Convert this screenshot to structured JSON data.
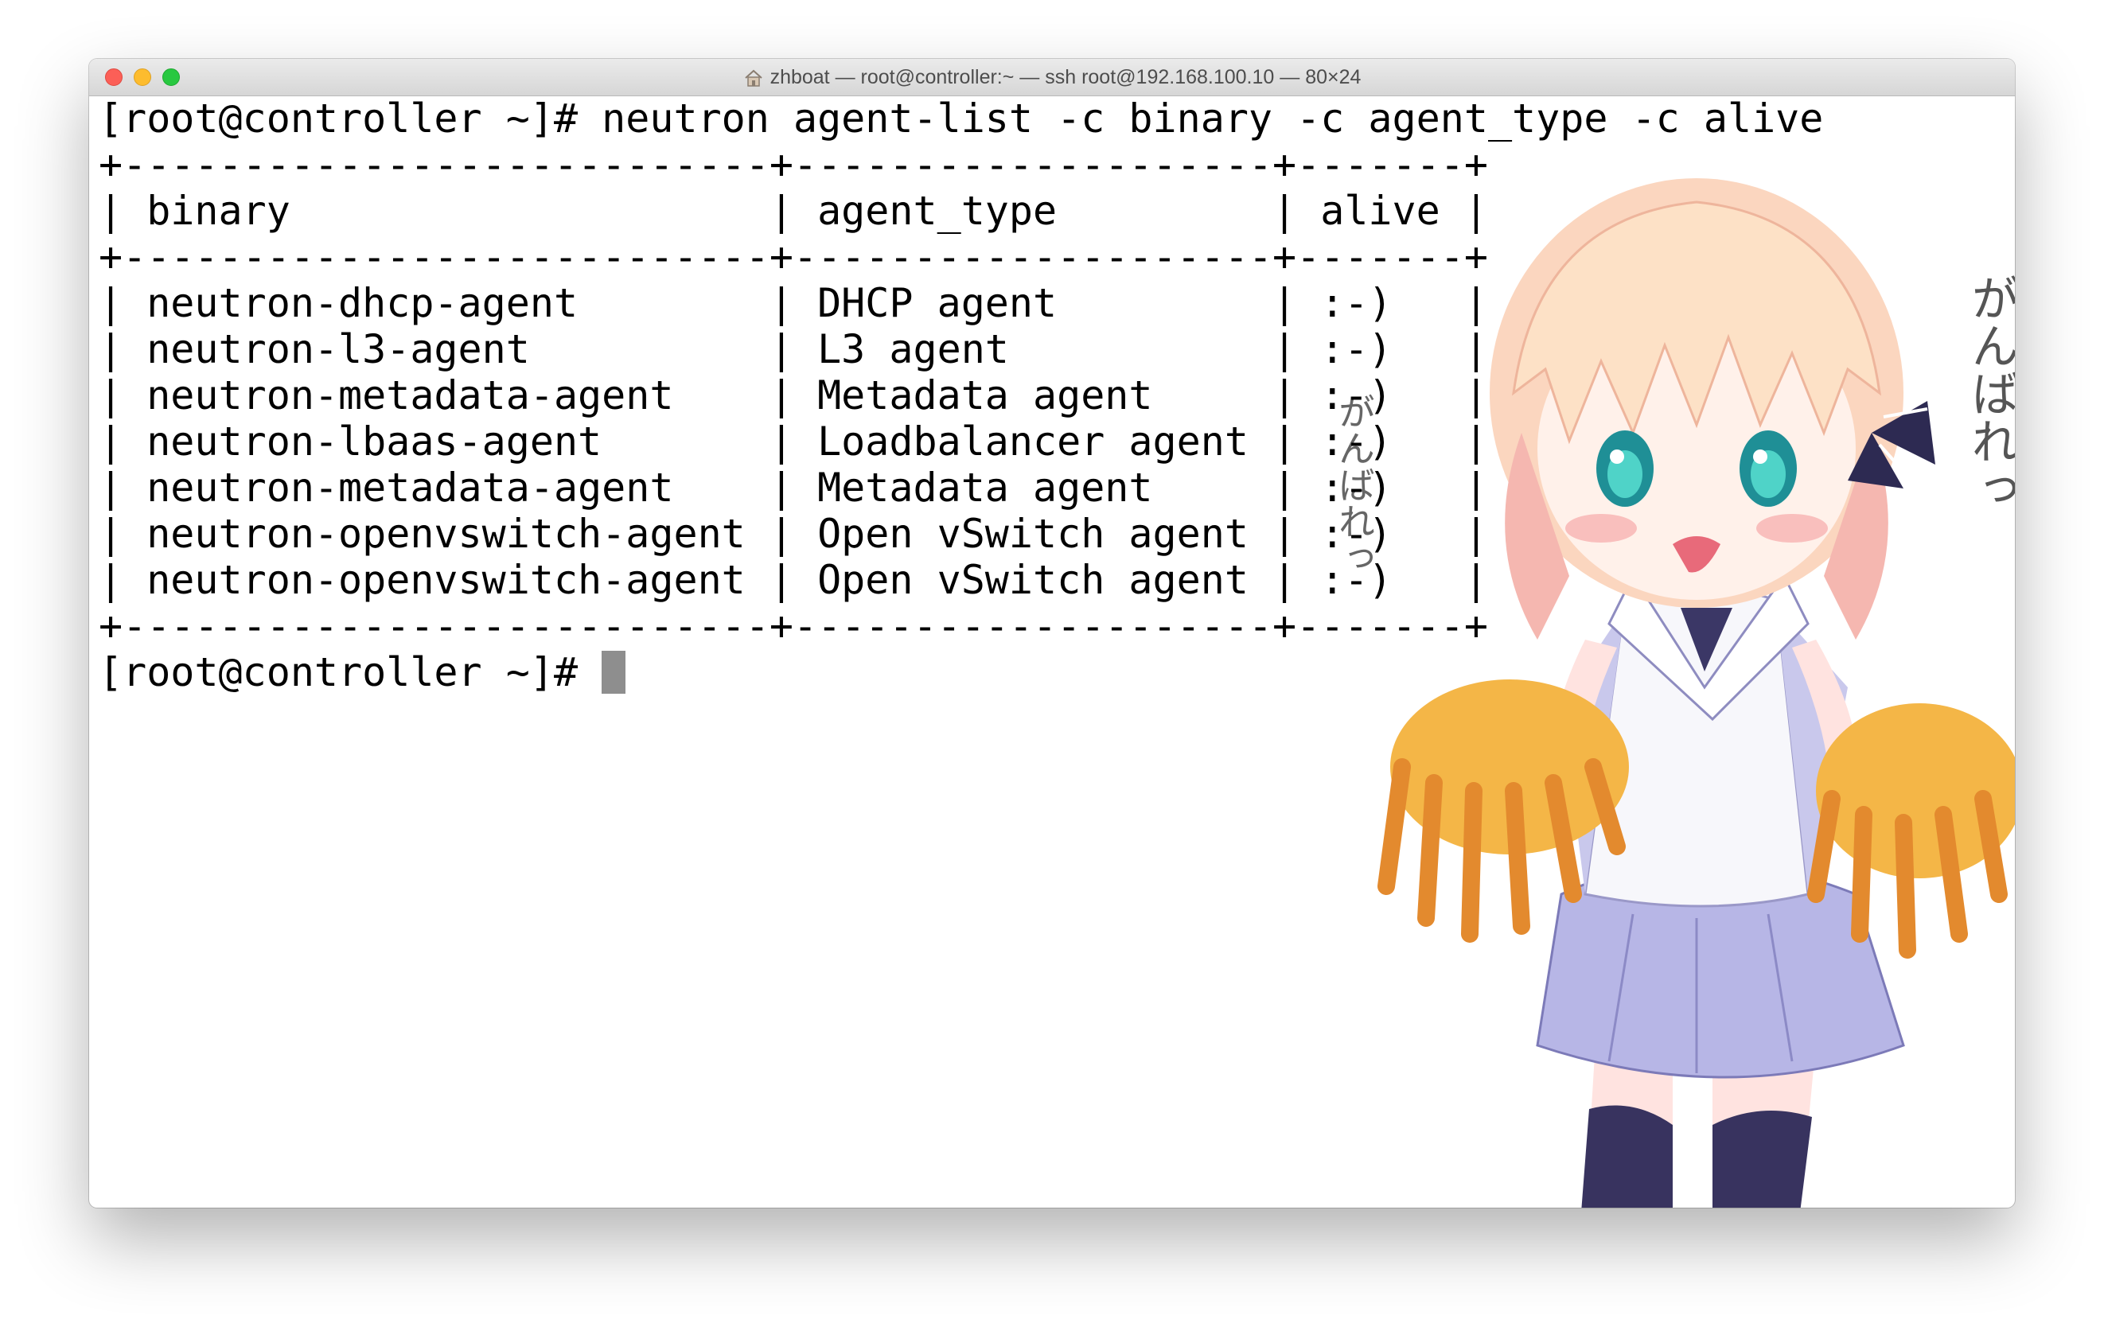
{
  "window": {
    "title": "zhboat — root@controller:~ — ssh root@192.168.100.10 — 80×24"
  },
  "terminal": {
    "prompt_command": "[root@controller ~]# neutron agent-list -c binary -c agent_type -c alive",
    "table_lines": [
      "+---------------------------+--------------------+-------+",
      "| binary                    | agent_type         | alive |",
      "+---------------------------+--------------------+-------+",
      "| neutron-dhcp-agent        | DHCP agent         | :-)   |",
      "| neutron-l3-agent          | L3 agent           | :-)   |",
      "| neutron-metadata-agent    | Metadata agent     | :-)   |",
      "| neutron-lbaas-agent       | Loadbalancer agent | :-)   |",
      "| neutron-metadata-agent    | Metadata agent     | :-)   |",
      "| neutron-openvswitch-agent | Open vSwitch agent | :-)   |",
      "| neutron-openvswitch-agent | Open vSwitch agent | :-)   |",
      "+---------------------------+--------------------+-------+"
    ],
    "final_prompt": "[root@controller ~]# "
  },
  "background_art": {
    "kana_right": "がんばれっ",
    "kana_middle": "がんばれっ"
  },
  "colors": {
    "close": "#fc5f57",
    "minimize": "#fdbc2e",
    "maximize": "#28c840",
    "cursor": "#8e8e8e",
    "text": "#000000"
  }
}
